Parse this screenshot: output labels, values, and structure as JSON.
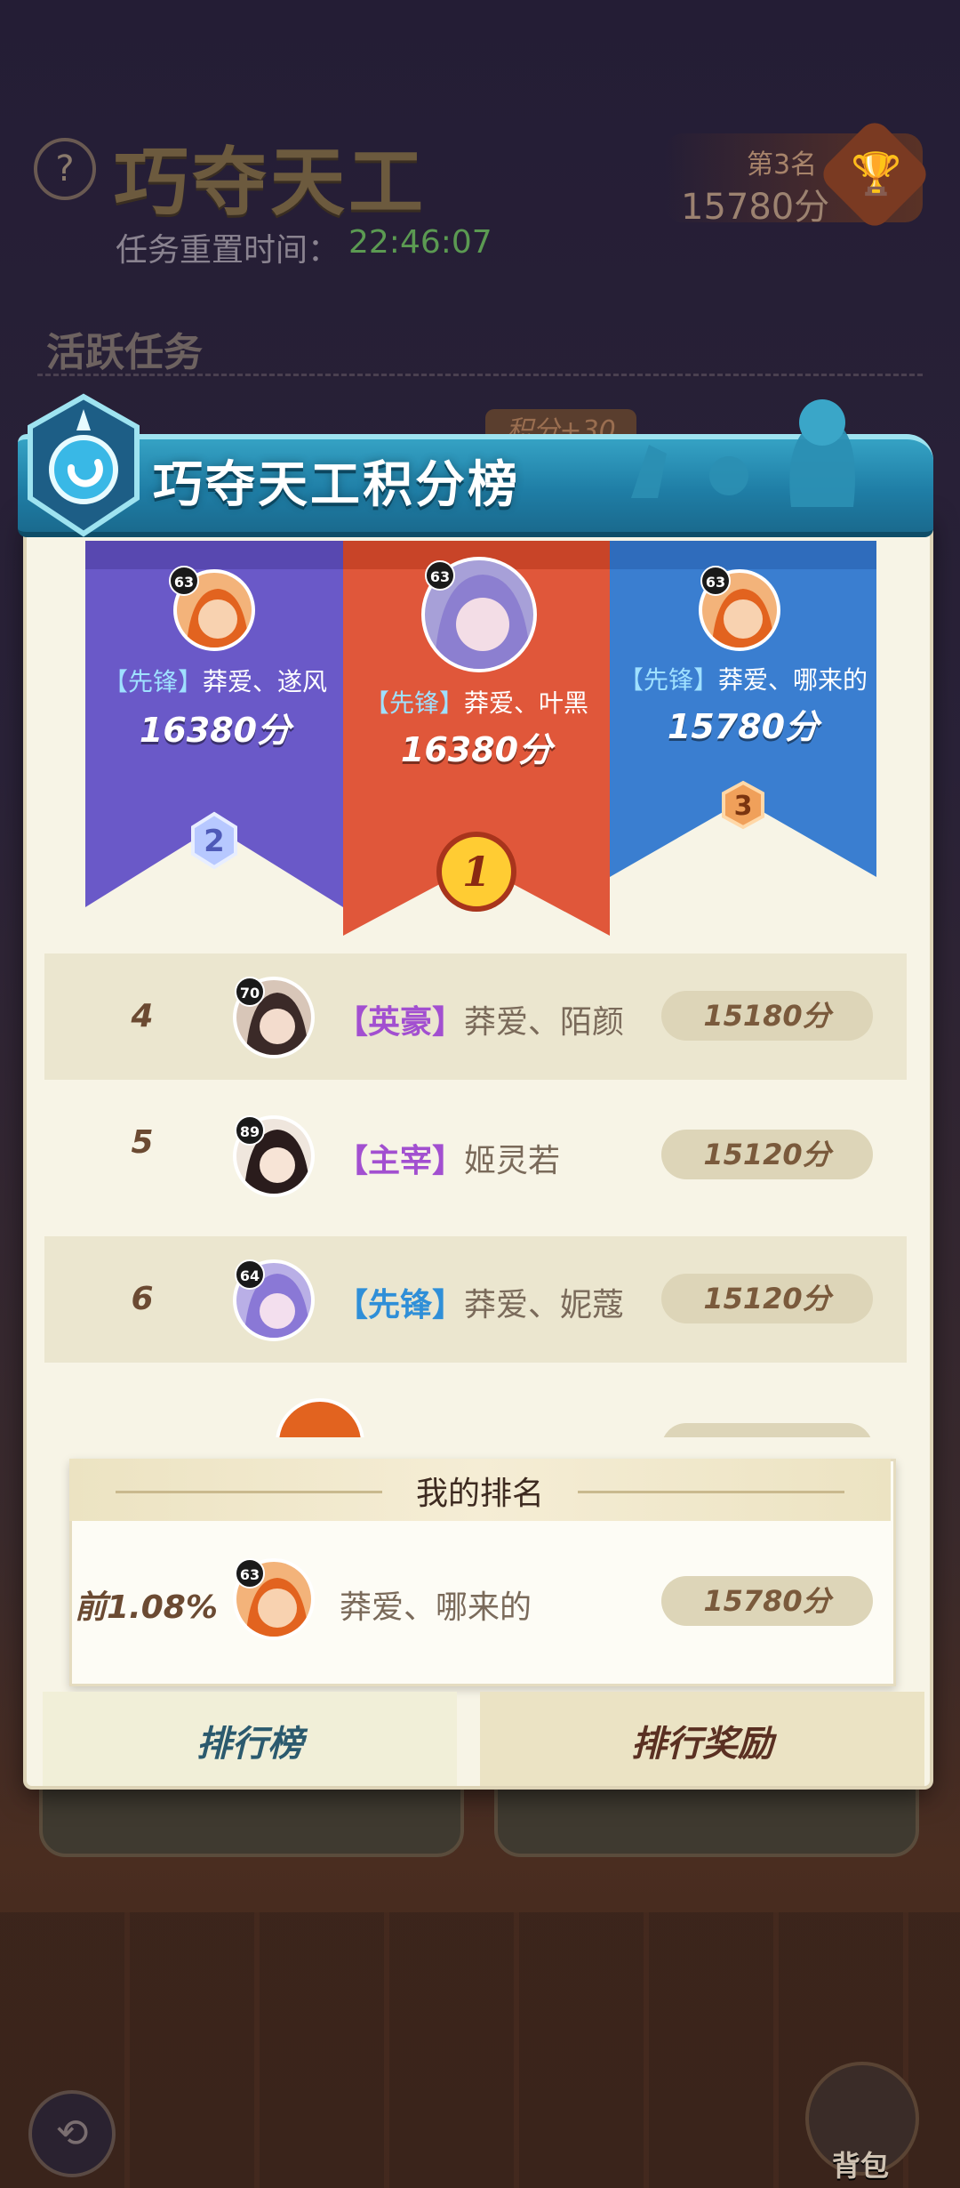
{
  "background": {
    "help_glyph": "?",
    "title": "巧夺天工",
    "reset_label": "任务重置时间：",
    "reset_time": "22:46:07",
    "rank_label": "第3名",
    "rank_score": "15780分",
    "active_tasks": "活跃任务",
    "bonus": "积分+30",
    "bag_label": "背包",
    "back_glyph": "⟲"
  },
  "panel": {
    "title": "巧夺天工积分榜"
  },
  "podium": [
    {
      "rank": 2,
      "level": "63",
      "tag": "【先锋】",
      "name": "莽爱、遂风",
      "score": "16380分",
      "color": "#6a59c8"
    },
    {
      "rank": 1,
      "level": "63",
      "tag": "【先锋】",
      "name": "莽爱、叶黑",
      "score": "16380分",
      "color": "#e0573a"
    },
    {
      "rank": 3,
      "level": "63",
      "tag": "【先锋】",
      "name": "莽爱、哪来的",
      "score": "15780分",
      "color": "#3a7ed0"
    }
  ],
  "rows": [
    {
      "rank": "4",
      "level": "70",
      "tag": "【英豪】",
      "tag_color": "#a24fd0",
      "name": "莽爱、陌颜",
      "score": "15180分"
    },
    {
      "rank": "5",
      "level": "89",
      "tag": "【主宰】",
      "tag_color": "#a24fd0",
      "name": "姬灵若",
      "score": "15120分"
    },
    {
      "rank": "6",
      "level": "64",
      "tag": "【先锋】",
      "tag_color": "#2f8fd8",
      "name": "莽爱、妮蔻",
      "score": "15120分"
    }
  ],
  "my_rank": {
    "header": "我的排名",
    "percent": "前1.08%",
    "level": "63",
    "name": "莽爱、哪来的",
    "score": "15780分"
  },
  "tabs": {
    "leaderboard": "排行榜",
    "rewards": "排行奖励"
  }
}
